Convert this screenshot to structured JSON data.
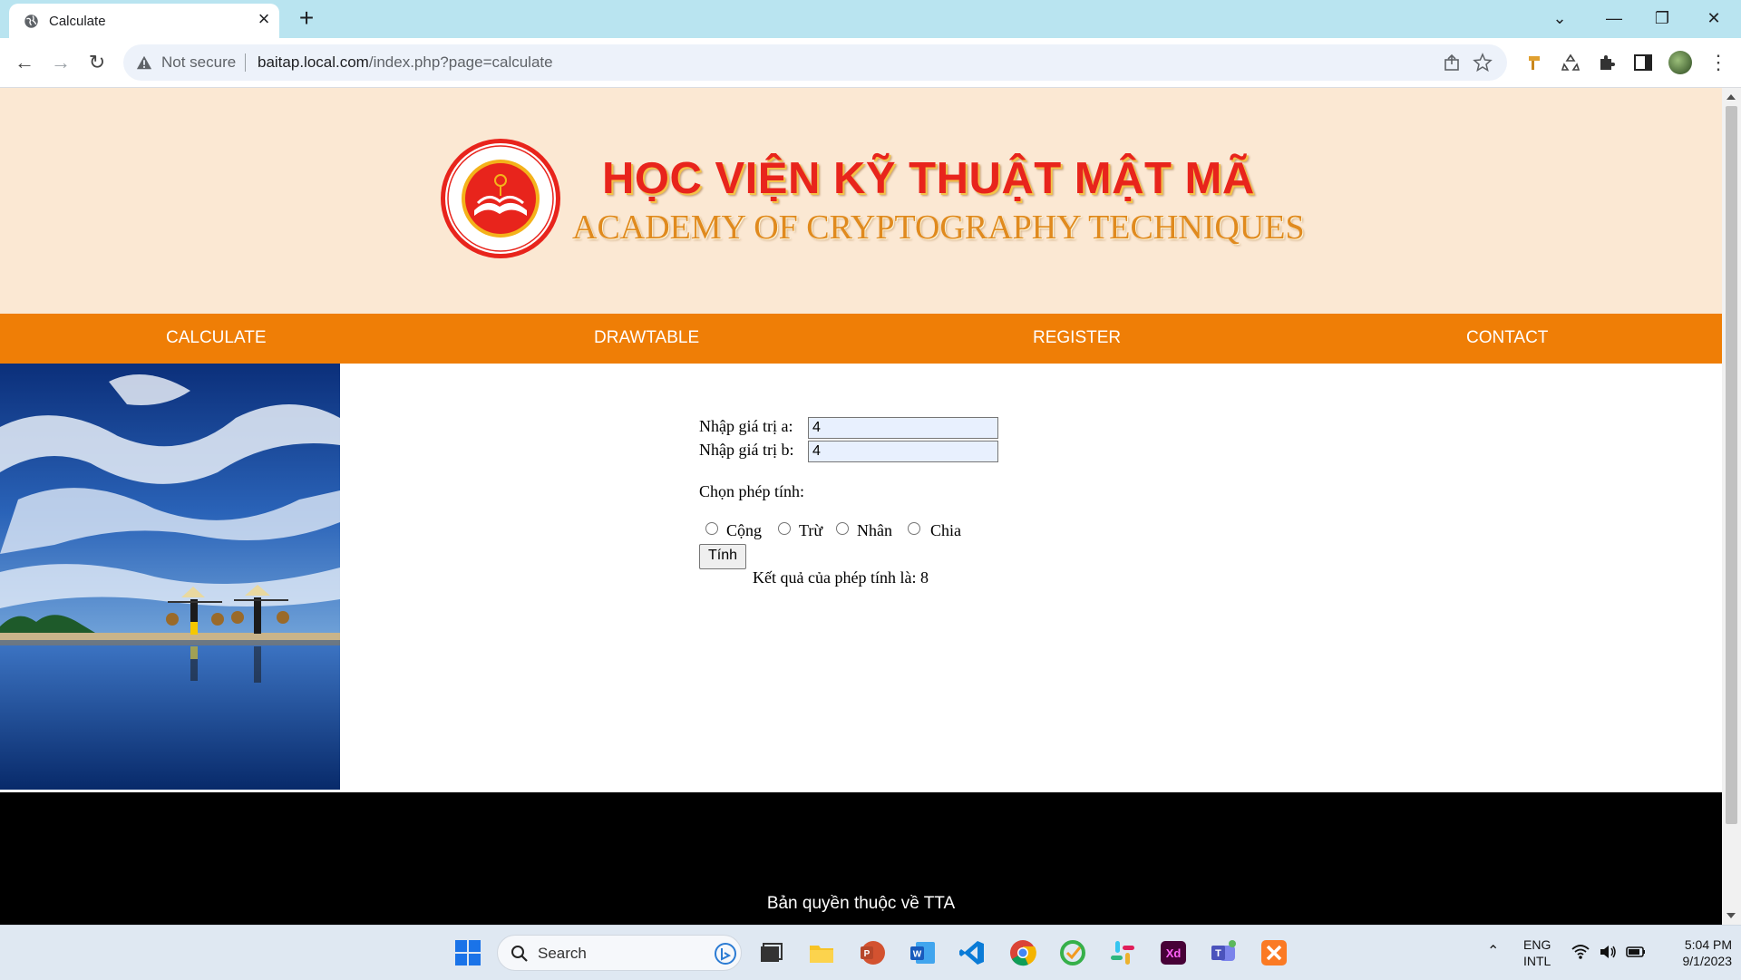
{
  "browser": {
    "tab_title": "Calculate",
    "security_label": "Not secure",
    "url_host": "baitap.local.com",
    "url_path": "/index.php?page=calculate"
  },
  "header": {
    "title_vn": "HỌC VIỆN KỸ THUẬT MẬT MÃ",
    "title_en": "ACADEMY OF CRYPTOGRAPHY TECHNIQUES"
  },
  "menu": {
    "items": [
      "CALCULATE",
      "DRAWTABLE",
      "REGISTER",
      "CONTACT"
    ]
  },
  "form": {
    "label_a": "Nhập giá trị a:",
    "value_a": "4",
    "label_b": "Nhập giá trị b:",
    "value_b": "4",
    "choose_label": "Chọn phép tính:",
    "operations": [
      "Cộng",
      "Trừ",
      "Nhân",
      "Chia"
    ],
    "submit_label": "Tính",
    "result_text": "Kết quả của phép tính là: 8"
  },
  "footer": {
    "copyright": "Bản quyền thuộc về TTA"
  },
  "taskbar": {
    "search_placeholder": "Search",
    "lang_top": "ENG",
    "lang_bottom": "INTL",
    "time": "5:04 PM",
    "date": "9/1/2023"
  },
  "colors": {
    "header_bg": "#fbe8d3",
    "menu_bg": "#ef7e06",
    "footer_bg": "#000000",
    "title_red": "#e8241c",
    "title_orange": "#e08a1e"
  }
}
